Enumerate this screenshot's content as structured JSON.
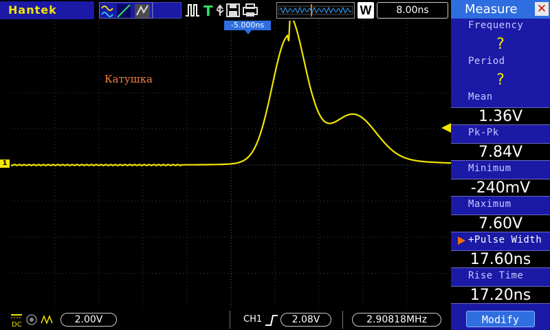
{
  "header": {
    "brand": "Hantek",
    "timebase": "8.00ns",
    "timeline_mode": "W"
  },
  "screen": {
    "trigger_position": "-5.000ns",
    "channel_marker": "1",
    "annotation": "Катушка",
    "trace_color": "#f2e600"
  },
  "footer": {
    "ch1_scale": "2.00V",
    "trigger_channel": "CH1",
    "trigger_level": "2.08V",
    "frequency": "2.90818MHz"
  },
  "measure": {
    "title": "Measure",
    "close_icon": "close-icon",
    "items": [
      {
        "label": "Frequency",
        "value": "?"
      },
      {
        "label": "Period",
        "value": "?"
      },
      {
        "label": "Mean",
        "value": "1.36V"
      },
      {
        "label": "Pk-Pk",
        "value": "7.84V"
      },
      {
        "label": "Minimum",
        "value": "-240mV"
      },
      {
        "label": "Maximum",
        "value": "7.60V"
      },
      {
        "label": "+Pulse Width",
        "value": "17.60ns"
      },
      {
        "label": "Rise Time",
        "value": "17.20ns"
      }
    ],
    "modify_label": "Modify"
  },
  "colors": {
    "accent_blue": "#1a1aa6",
    "highlight_blue": "#2f6ee0",
    "trace_yellow": "#f2e600"
  }
}
